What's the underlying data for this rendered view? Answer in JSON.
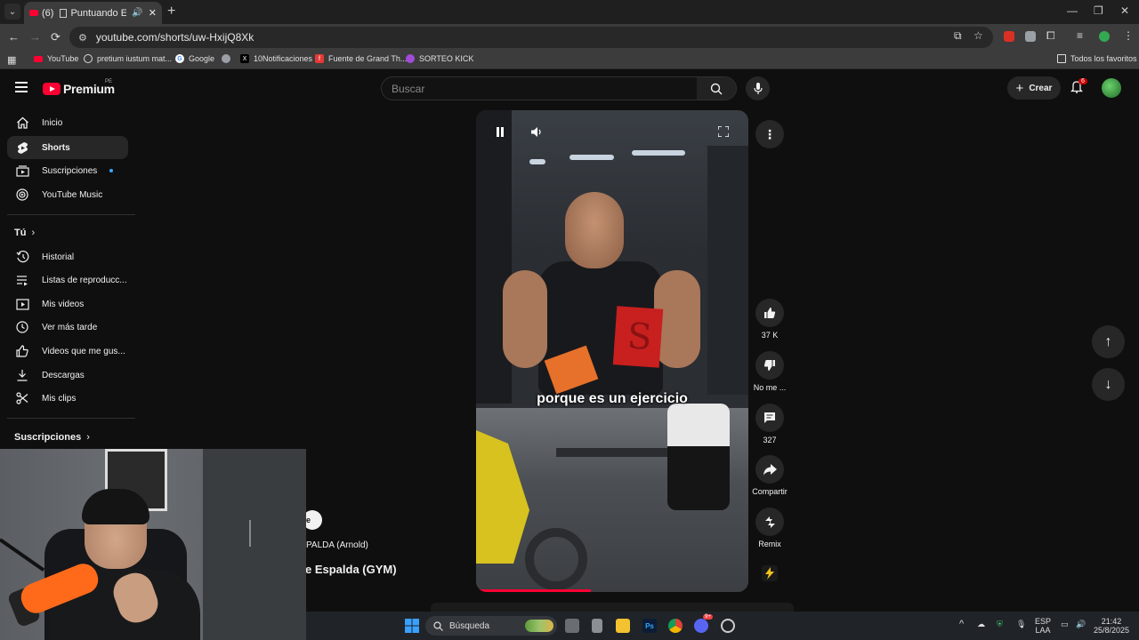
{
  "browser": {
    "tab_title": "Puntuando Ejercicios",
    "tab_count_prefix": "(6)",
    "tab_close": "✕",
    "new_tab": "+",
    "url": "youtube.com/shorts/uw-HxijQ8Xk",
    "window_controls": [
      "—",
      "❐",
      "✕"
    ]
  },
  "bookmarks": {
    "items": [
      {
        "label": "YouTube",
        "color": "#ff0033"
      },
      {
        "label": "pretium iustum mat...",
        "color": "#dddddd"
      },
      {
        "label": "Google",
        "color": "#4285f4"
      },
      {
        "label": "",
        "color": "#9aa0a6"
      },
      {
        "label": "10Notificaciones",
        "color": "#000000"
      },
      {
        "label": "Fuente de Grand Th...",
        "color": "#e53935"
      },
      {
        "label": "SORTEO KICK",
        "color": "#a24bd6"
      }
    ],
    "all_favorites": "Todos los favoritos"
  },
  "yt": {
    "logo_text": "Premium",
    "logo_region": "PE",
    "search_placeholder": "Buscar",
    "create_label": "Crear",
    "notif_count": "6"
  },
  "sidebar": {
    "main": [
      {
        "label": "Inicio",
        "icon": "home-icon"
      },
      {
        "label": "Shorts",
        "icon": "shorts-icon",
        "active": true
      },
      {
        "label": "Suscripciones",
        "icon": "subscriptions-icon",
        "dot": true
      },
      {
        "label": "YouTube Music",
        "icon": "music-icon"
      }
    ],
    "you_heading": "Tú",
    "you": [
      {
        "label": "Historial",
        "icon": "history-icon"
      },
      {
        "label": "Listas de reproducc...",
        "icon": "playlist-icon"
      },
      {
        "label": "Mis videos",
        "icon": "my-videos-icon"
      },
      {
        "label": "Ver más tarde",
        "icon": "watch-later-icon"
      },
      {
        "label": "Videos que me gus...",
        "icon": "like-icon"
      },
      {
        "label": "Descargas",
        "icon": "download-icon"
      },
      {
        "label": "Mis clips",
        "icon": "scissors-icon"
      }
    ],
    "subs_heading": "Suscripciones"
  },
  "short": {
    "caption": "porque es un ejercicio",
    "progress": 0.42,
    "likes": "37 K",
    "dislike_label": "No me ...",
    "comments": "327",
    "share_label": "Compartir",
    "remix_label": "Remix",
    "chip_text": "e",
    "sub_line": "PALDA (Arnold)",
    "title_line": "e Espalda (GYM)"
  },
  "taskbar": {
    "search_label": "Búsqueda",
    "lang_line1": "ESP",
    "lang_line2": "LAA",
    "time": "21:42",
    "date": "25/8/2025",
    "discord_badge": "9+"
  }
}
